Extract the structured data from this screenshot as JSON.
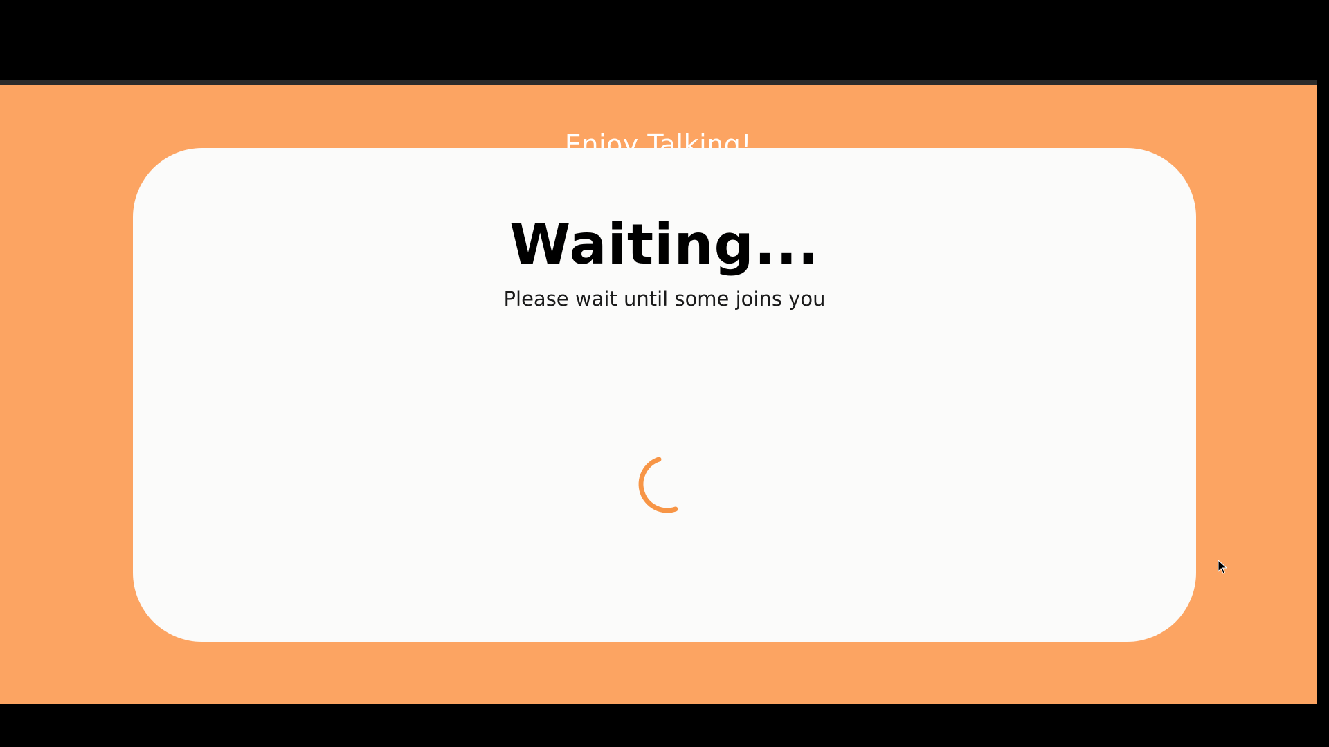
{
  "page": {
    "heading": "Enjoy Talking!"
  },
  "card": {
    "title": "Waiting...",
    "subtitle": "Please wait until some joins you"
  },
  "spinner": {
    "icon": "loading-spinner-icon",
    "color": "#f79546"
  },
  "colors": {
    "background": "#fca462",
    "card": "#fbfbfa",
    "title": "#000000",
    "subtitle": "#1a1a1a",
    "accent": "#f79546",
    "frame": "#000000"
  }
}
